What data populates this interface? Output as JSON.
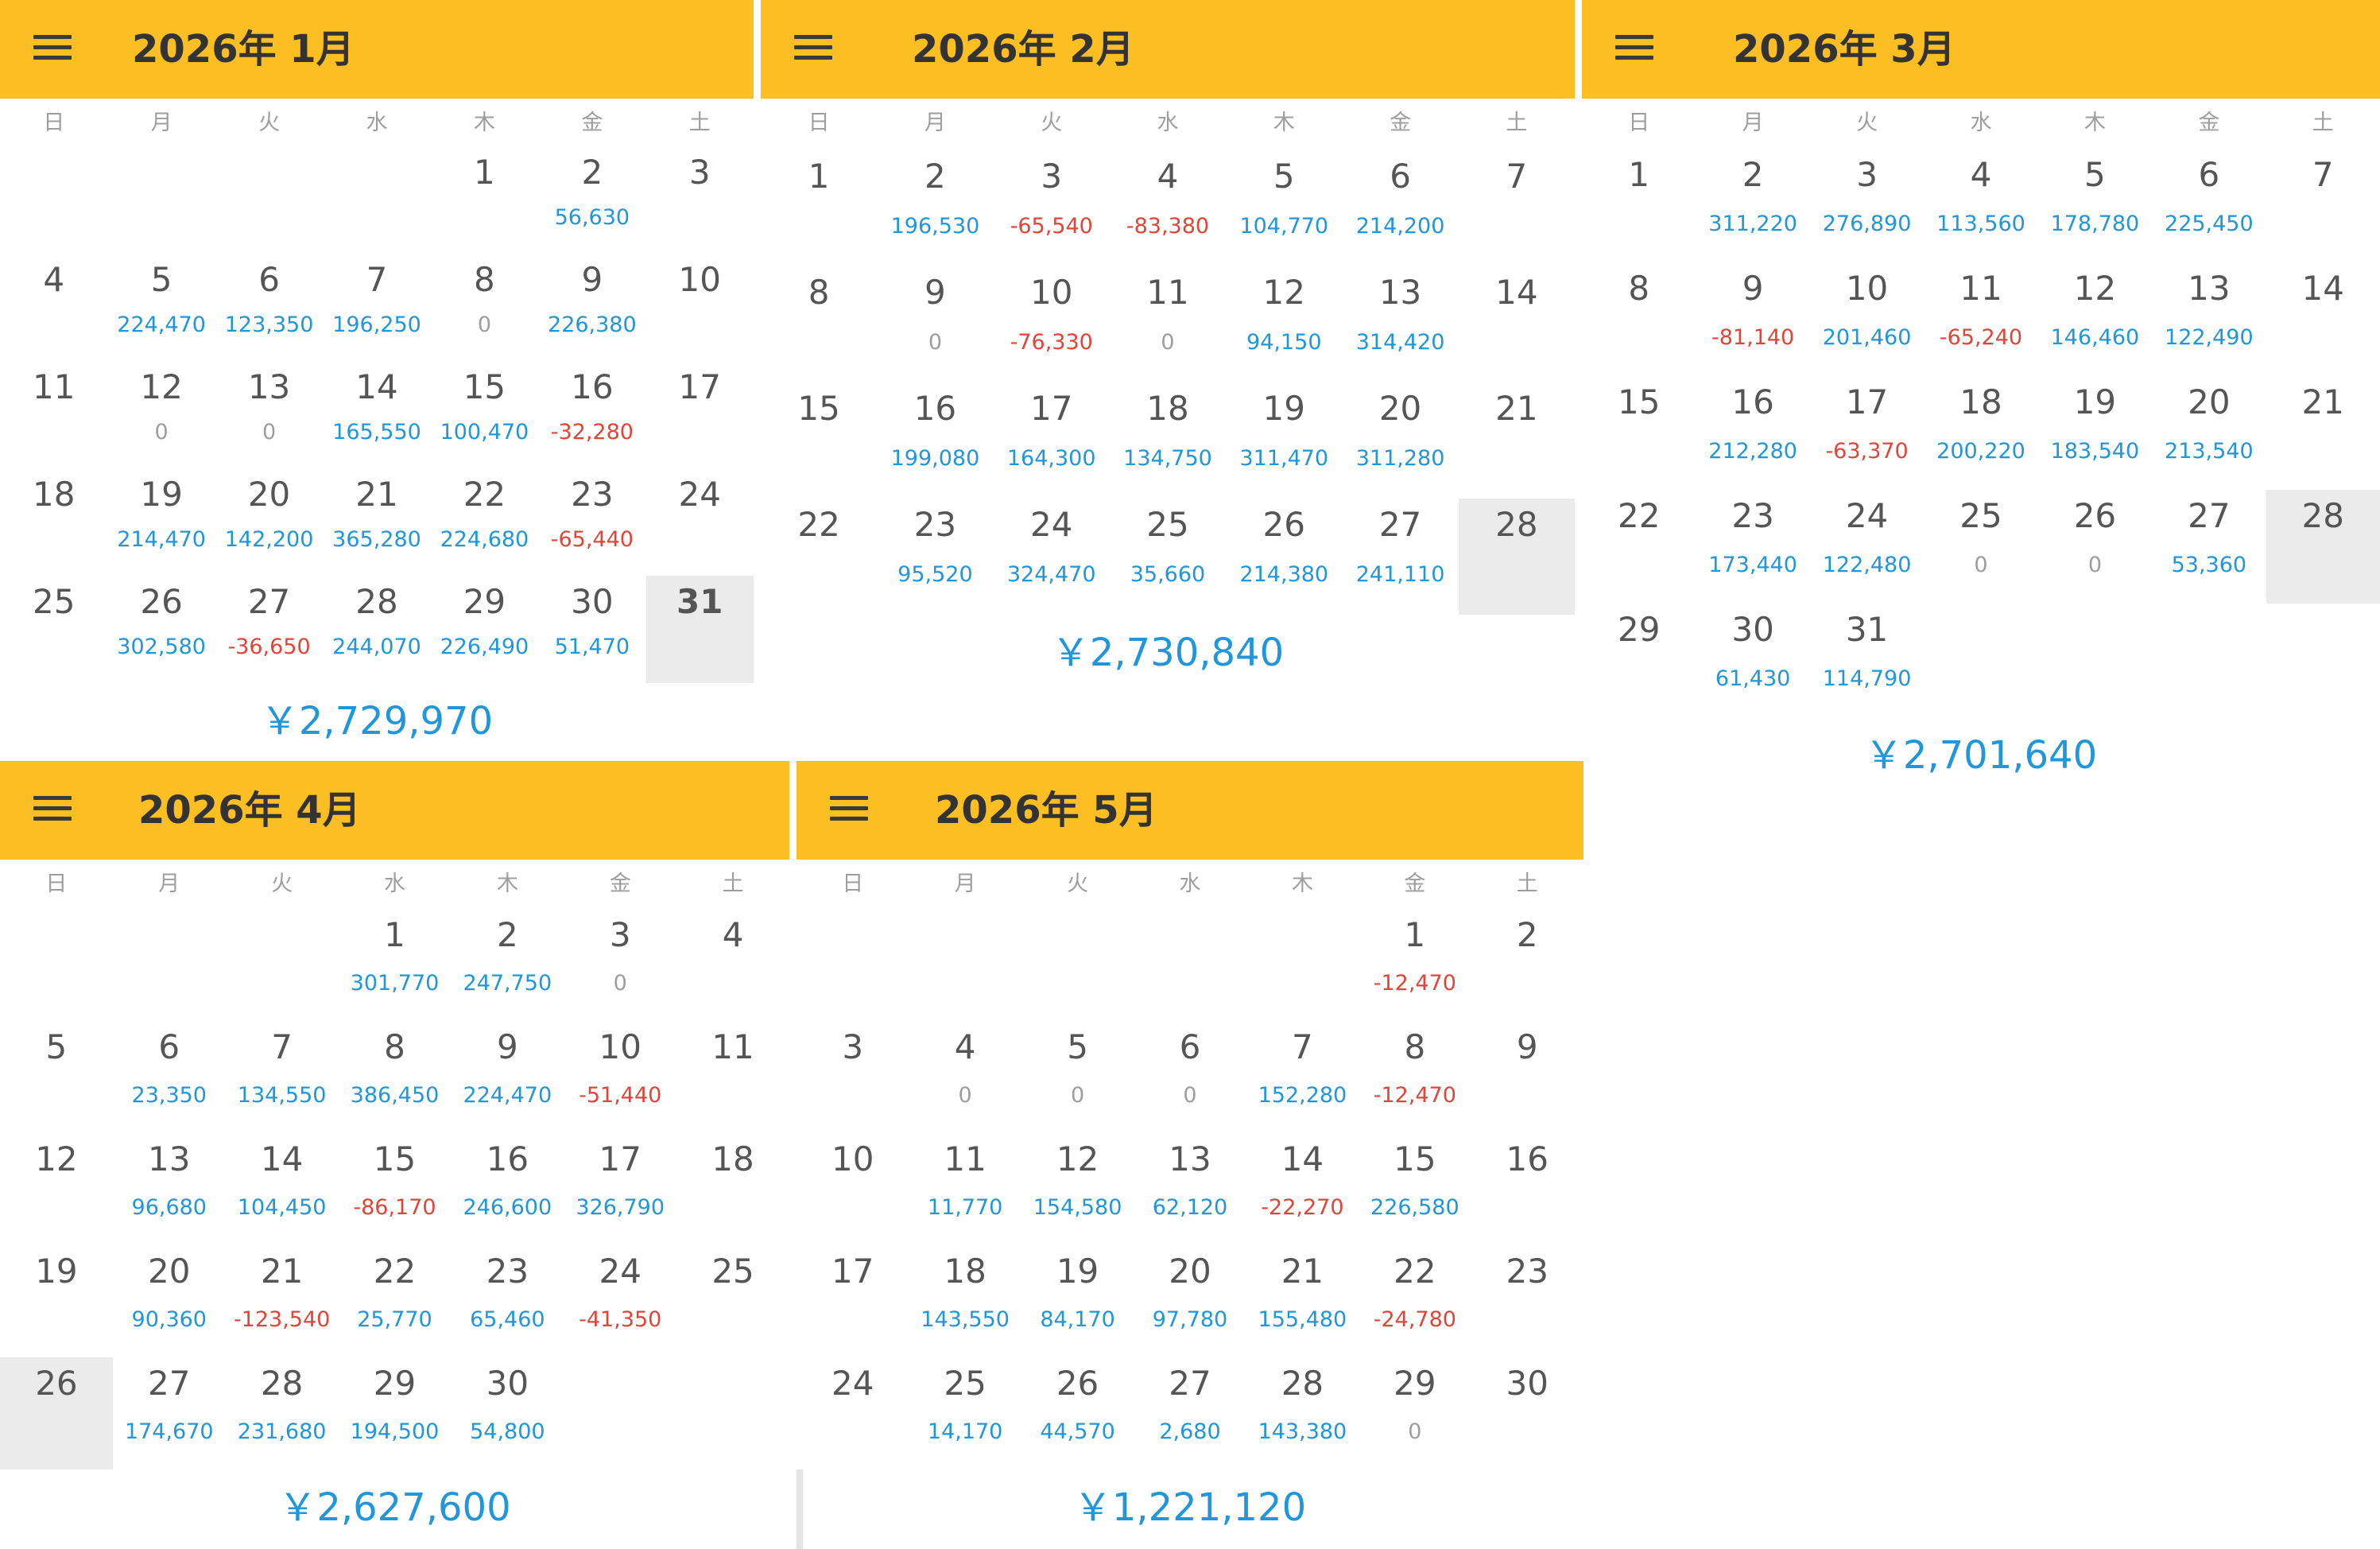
{
  "colors": {
    "header": "#fbbf24",
    "positive": "#2196d8",
    "negative": "#e0453a",
    "zero": "#9e9e9e",
    "today_bg": "#ebebeb"
  },
  "weekdays": [
    "日",
    "月",
    "火",
    "水",
    "木",
    "金",
    "土"
  ],
  "months": [
    {
      "title": "2026年 1月",
      "total": "￥2,729,970",
      "today": 31,
      "days": [
        {
          "d": "1"
        },
        {
          "d": "2",
          "a": "56,630"
        },
        {
          "d": "3"
        },
        {
          "d": "4"
        },
        {
          "d": "5",
          "a": "224,470"
        },
        {
          "d": "6",
          "a": "123,350"
        },
        {
          "d": "7",
          "a": "196,250"
        },
        {
          "d": "8",
          "a": "0"
        },
        {
          "d": "9",
          "a": "226,380"
        },
        {
          "d": "10"
        },
        {
          "d": "11"
        },
        {
          "d": "12",
          "a": "0"
        },
        {
          "d": "13",
          "a": "0"
        },
        {
          "d": "14",
          "a": "165,550"
        },
        {
          "d": "15",
          "a": "100,470"
        },
        {
          "d": "16",
          "a": "-32,280"
        },
        {
          "d": "17"
        },
        {
          "d": "18"
        },
        {
          "d": "19",
          "a": "214,470"
        },
        {
          "d": "20",
          "a": "142,200"
        },
        {
          "d": "21",
          "a": "365,280"
        },
        {
          "d": "22",
          "a": "224,680"
        },
        {
          "d": "23",
          "a": "-65,440"
        },
        {
          "d": "24"
        },
        {
          "d": "25"
        },
        {
          "d": "26",
          "a": "302,580"
        },
        {
          "d": "27",
          "a": "-36,650"
        },
        {
          "d": "28",
          "a": "244,070"
        },
        {
          "d": "29",
          "a": "226,490"
        },
        {
          "d": "30",
          "a": "51,470"
        },
        {
          "d": "31"
        }
      ]
    },
    {
      "title": "2026年 2月",
      "total": "￥2,730,840",
      "today": 28,
      "days": [
        {
          "d": "1"
        },
        {
          "d": "2",
          "a": "196,530"
        },
        {
          "d": "3",
          "a": "-65,540"
        },
        {
          "d": "4",
          "a": "-83,380"
        },
        {
          "d": "5",
          "a": "104,770"
        },
        {
          "d": "6",
          "a": "214,200"
        },
        {
          "d": "7"
        },
        {
          "d": "8"
        },
        {
          "d": "9",
          "a": "0"
        },
        {
          "d": "10",
          "a": "-76,330"
        },
        {
          "d": "11",
          "a": "0"
        },
        {
          "d": "12",
          "a": "94,150"
        },
        {
          "d": "13",
          "a": "314,420"
        },
        {
          "d": "14"
        },
        {
          "d": "15"
        },
        {
          "d": "16",
          "a": "199,080"
        },
        {
          "d": "17",
          "a": "164,300"
        },
        {
          "d": "18",
          "a": "134,750"
        },
        {
          "d": "19",
          "a": "311,470"
        },
        {
          "d": "20",
          "a": "311,280"
        },
        {
          "d": "21"
        },
        {
          "d": "22"
        },
        {
          "d": "23",
          "a": "95,520"
        },
        {
          "d": "24",
          "a": "324,470"
        },
        {
          "d": "25",
          "a": "35,660"
        },
        {
          "d": "26",
          "a": "214,380"
        },
        {
          "d": "27",
          "a": "241,110"
        },
        {
          "d": "28"
        }
      ]
    },
    {
      "title": "2026年 3月",
      "total": "￥2,701,640",
      "today": 28,
      "days": [
        {
          "d": "1"
        },
        {
          "d": "2",
          "a": "311,220"
        },
        {
          "d": "3",
          "a": "276,890"
        },
        {
          "d": "4",
          "a": "113,560"
        },
        {
          "d": "5",
          "a": "178,780"
        },
        {
          "d": "6",
          "a": "225,450"
        },
        {
          "d": "7"
        },
        {
          "d": "8"
        },
        {
          "d": "9",
          "a": "-81,140"
        },
        {
          "d": "10",
          "a": "201,460"
        },
        {
          "d": "11",
          "a": "-65,240"
        },
        {
          "d": "12",
          "a": "146,460"
        },
        {
          "d": "13",
          "a": "122,490"
        },
        {
          "d": "14"
        },
        {
          "d": "15"
        },
        {
          "d": "16",
          "a": "212,280"
        },
        {
          "d": "17",
          "a": "-63,370"
        },
        {
          "d": "18",
          "a": "200,220"
        },
        {
          "d": "19",
          "a": "183,540"
        },
        {
          "d": "20",
          "a": "213,540"
        },
        {
          "d": "21"
        },
        {
          "d": "22"
        },
        {
          "d": "23",
          "a": "173,440"
        },
        {
          "d": "24",
          "a": "122,480"
        },
        {
          "d": "25",
          "a": "0"
        },
        {
          "d": "26",
          "a": "0"
        },
        {
          "d": "27",
          "a": "53,360"
        },
        {
          "d": "28"
        },
        {
          "d": "29"
        },
        {
          "d": "30",
          "a": "61,430"
        },
        {
          "d": "31",
          "a": "114,790"
        }
      ]
    },
    {
      "title": "2026年 4月",
      "total": "￥2,627,600",
      "today": 26,
      "days": [
        {
          "d": "1",
          "a": "301,770"
        },
        {
          "d": "2",
          "a": "247,750"
        },
        {
          "d": "3",
          "a": "0"
        },
        {
          "d": "4"
        },
        {
          "d": "5"
        },
        {
          "d": "6",
          "a": "23,350"
        },
        {
          "d": "7",
          "a": "134,550"
        },
        {
          "d": "8",
          "a": "386,450"
        },
        {
          "d": "9",
          "a": "224,470"
        },
        {
          "d": "10",
          "a": "-51,440"
        },
        {
          "d": "11"
        },
        {
          "d": "12"
        },
        {
          "d": "13",
          "a": "96,680"
        },
        {
          "d": "14",
          "a": "104,450"
        },
        {
          "d": "15",
          "a": "-86,170"
        },
        {
          "d": "16",
          "a": "246,600"
        },
        {
          "d": "17",
          "a": "326,790"
        },
        {
          "d": "18"
        },
        {
          "d": "19"
        },
        {
          "d": "20",
          "a": "90,360"
        },
        {
          "d": "21",
          "a": "-123,540"
        },
        {
          "d": "22",
          "a": "25,770"
        },
        {
          "d": "23",
          "a": "65,460"
        },
        {
          "d": "24",
          "a": "-41,350"
        },
        {
          "d": "25"
        },
        {
          "d": "26"
        },
        {
          "d": "27",
          "a": "174,670"
        },
        {
          "d": "28",
          "a": "231,680"
        },
        {
          "d": "29",
          "a": "194,500"
        },
        {
          "d": "30",
          "a": "54,800"
        }
      ]
    },
    {
      "title": "2026年 5月",
      "total": "￥1,221,120",
      "today": 0,
      "days": [
        {
          "d": "1",
          "a": "-12,470"
        },
        {
          "d": "2"
        },
        {
          "d": "3"
        },
        {
          "d": "4",
          "a": "0"
        },
        {
          "d": "5",
          "a": "0"
        },
        {
          "d": "6",
          "a": "0"
        },
        {
          "d": "7",
          "a": "152,280"
        },
        {
          "d": "8",
          "a": "-12,470"
        },
        {
          "d": "9"
        },
        {
          "d": "10"
        },
        {
          "d": "11",
          "a": "11,770"
        },
        {
          "d": "12",
          "a": "154,580"
        },
        {
          "d": "13",
          "a": "62,120"
        },
        {
          "d": "14",
          "a": "-22,270"
        },
        {
          "d": "15",
          "a": "226,580"
        },
        {
          "d": "16"
        },
        {
          "d": "17"
        },
        {
          "d": "18",
          "a": "143,550"
        },
        {
          "d": "19",
          "a": "84,170"
        },
        {
          "d": "20",
          "a": "97,780"
        },
        {
          "d": "21",
          "a": "155,480"
        },
        {
          "d": "22",
          "a": "-24,780"
        },
        {
          "d": "23"
        },
        {
          "d": "24"
        },
        {
          "d": "25",
          "a": "14,170"
        },
        {
          "d": "26",
          "a": "44,570"
        },
        {
          "d": "27",
          "a": "2,680"
        },
        {
          "d": "28",
          "a": "143,380"
        },
        {
          "d": "29",
          "a": "0"
        },
        {
          "d": "30"
        }
      ]
    }
  ]
}
